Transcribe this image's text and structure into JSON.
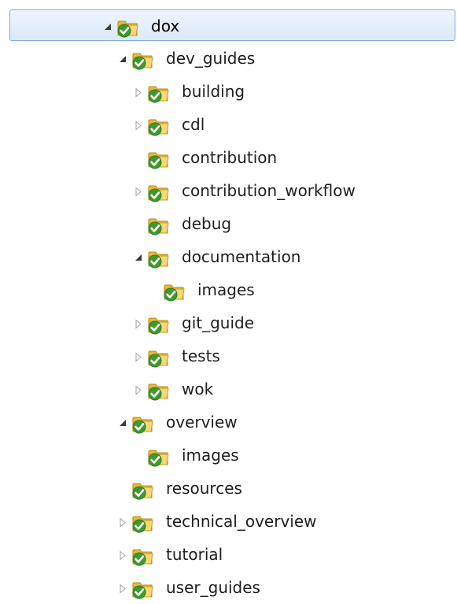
{
  "tree": {
    "items": [
      {
        "label": "dox",
        "level": 0,
        "toggle": "expanded",
        "selected": true
      },
      {
        "label": "dev_guides",
        "level": 1,
        "toggle": "expanded"
      },
      {
        "label": "building",
        "level": 2,
        "toggle": "collapsed"
      },
      {
        "label": "cdl",
        "level": 2,
        "toggle": "collapsed"
      },
      {
        "label": "contribution",
        "level": 2,
        "toggle": "none"
      },
      {
        "label": "contribution_workflow",
        "level": 2,
        "toggle": "collapsed"
      },
      {
        "label": "debug",
        "level": 2,
        "toggle": "none"
      },
      {
        "label": "documentation",
        "level": 2,
        "toggle": "expanded"
      },
      {
        "label": "images",
        "level": 3,
        "toggle": "none"
      },
      {
        "label": "git_guide",
        "level": 2,
        "toggle": "collapsed"
      },
      {
        "label": "tests",
        "level": 2,
        "toggle": "collapsed"
      },
      {
        "label": "wok",
        "level": 2,
        "toggle": "collapsed"
      },
      {
        "label": "overview",
        "level": 1,
        "toggle": "expanded"
      },
      {
        "label": "images",
        "level": 2,
        "toggle": "none"
      },
      {
        "label": "resources",
        "level": 1,
        "toggle": "none"
      },
      {
        "label": "technical_overview",
        "level": 1,
        "toggle": "collapsed"
      },
      {
        "label": "tutorial",
        "level": 1,
        "toggle": "collapsed"
      },
      {
        "label": "user_guides",
        "level": 1,
        "toggle": "collapsed"
      }
    ],
    "folder_icon": "folder-synced-icon",
    "colors": {
      "selection_border": "#84acdd",
      "selection_fill": "#dbe9fa",
      "folder": "#f2cc5c",
      "check": "#3f9a2e"
    }
  }
}
